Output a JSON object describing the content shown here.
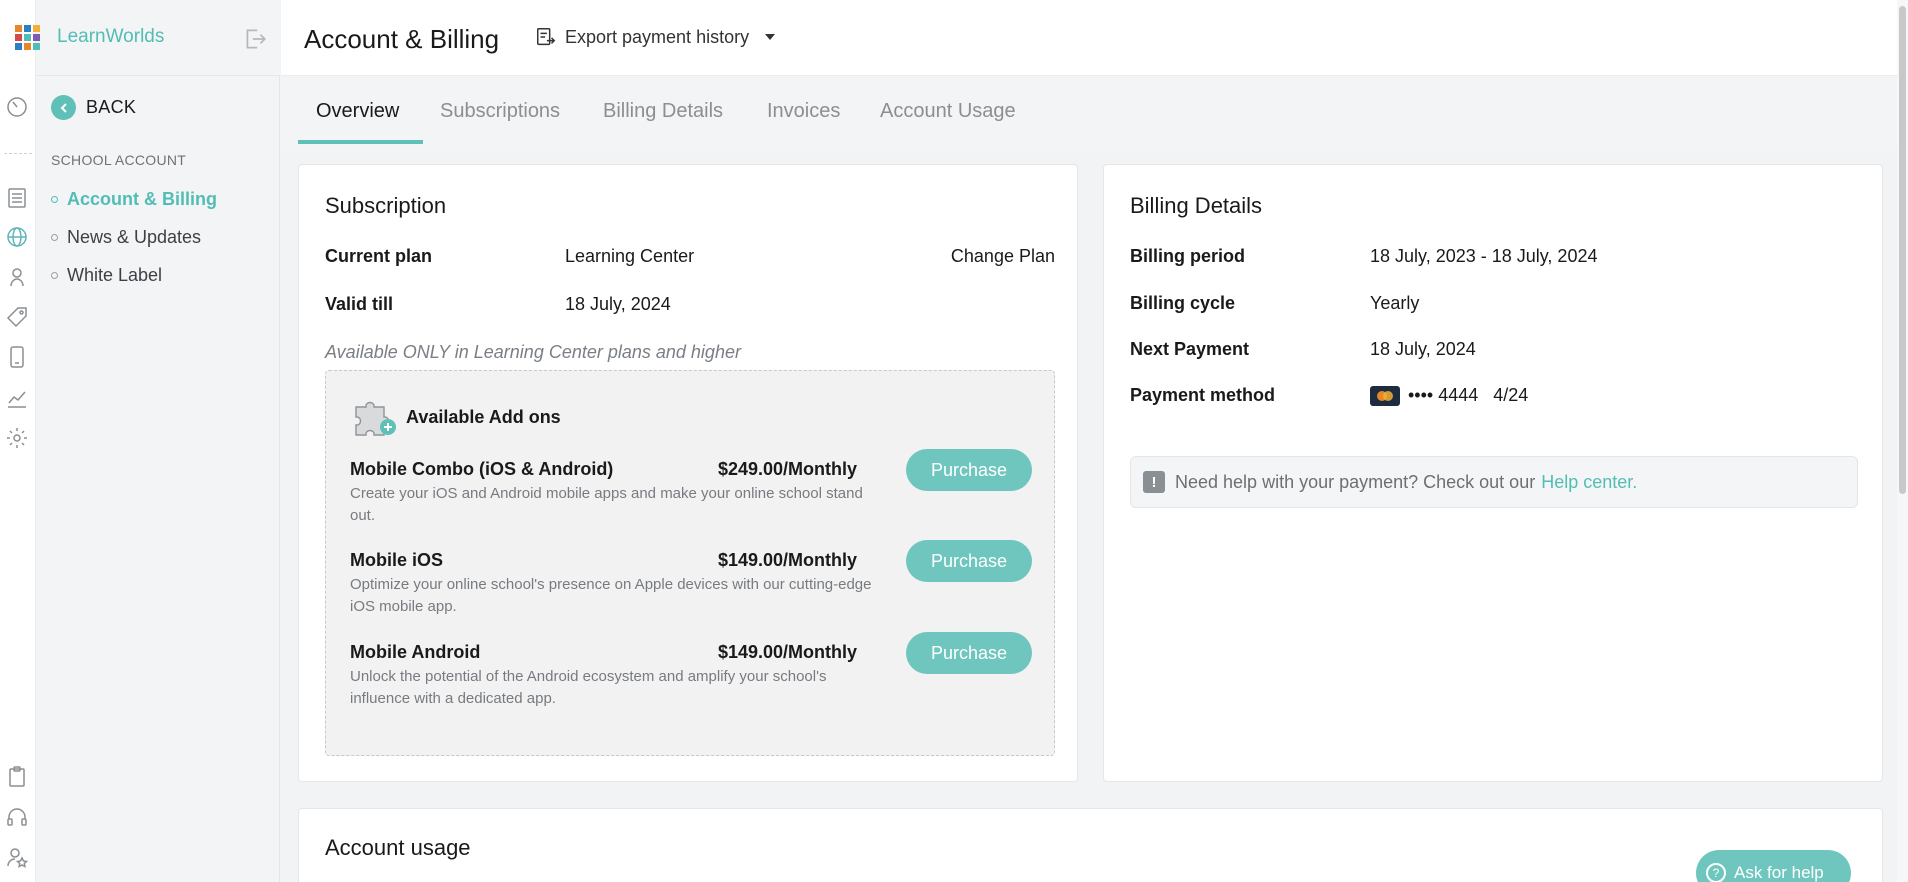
{
  "brand": {
    "name": "LearnWorlds"
  },
  "colors": {
    "accent": "#52bdb5",
    "button": "#6fc6bf",
    "card_chip": "#1d2d3f"
  },
  "sidebar": {
    "back_label": "BACK",
    "section_header": "SCHOOL ACCOUNT",
    "items": [
      {
        "label": "Account & Billing",
        "active": true
      },
      {
        "label": "News & Updates",
        "active": false
      },
      {
        "label": "White Label",
        "active": false
      }
    ]
  },
  "rail_icons": [
    "dashboard-gauge-icon",
    "pages-icon",
    "globe-icon",
    "users-icon",
    "tag-icon",
    "mobile-icon",
    "analytics-icon",
    "settings-gear-icon",
    "clipboard-icon",
    "headset-icon",
    "star-user-icon"
  ],
  "header": {
    "title": "Account & Billing",
    "export_label": "Export payment history"
  },
  "tabs": [
    {
      "label": "Overview",
      "active": true
    },
    {
      "label": "Subscriptions",
      "active": false
    },
    {
      "label": "Billing Details",
      "active": false
    },
    {
      "label": "Invoices",
      "active": false
    },
    {
      "label": "Account Usage",
      "active": false
    }
  ],
  "subscription": {
    "title": "Subscription",
    "current_plan_label": "Current plan",
    "current_plan_value": "Learning Center",
    "change_plan": "Change Plan",
    "valid_till_label": "Valid till",
    "valid_till_value": "18 July, 2024",
    "note": "Available ONLY in Learning Center plans and higher",
    "addons_title": "Available Add ons",
    "addons": [
      {
        "name": "Mobile Combo (iOS & Android)",
        "price": "$249.00/Monthly",
        "description": "Create your iOS and Android mobile apps and make your online school stand out.",
        "button": "Purchase"
      },
      {
        "name": "Mobile iOS",
        "price": "$149.00/Monthly",
        "description": "Optimize your online school's presence on Apple devices with our cutting-edge iOS mobile app.",
        "button": "Purchase"
      },
      {
        "name": "Mobile Android",
        "price": "$149.00/Monthly",
        "description": "Unlock the potential of the Android ecosystem and amplify your school's influence with a dedicated app.",
        "button": "Purchase"
      }
    ]
  },
  "billing": {
    "title": "Billing Details",
    "period_label": "Billing period",
    "period_value": "18 July, 2023 - 18 July, 2024",
    "cycle_label": "Billing cycle",
    "cycle_value": "Yearly",
    "next_payment_label": "Next Payment",
    "next_payment_value": "18 July, 2024",
    "method_label": "Payment method",
    "card_number": "•••• 4444",
    "card_expiry": "4/24",
    "help_text": "Need help with your payment? Check out our",
    "help_link": "Help center."
  },
  "account_usage": {
    "title": "Account usage"
  },
  "ask_help": {
    "label": "Ask for help"
  }
}
